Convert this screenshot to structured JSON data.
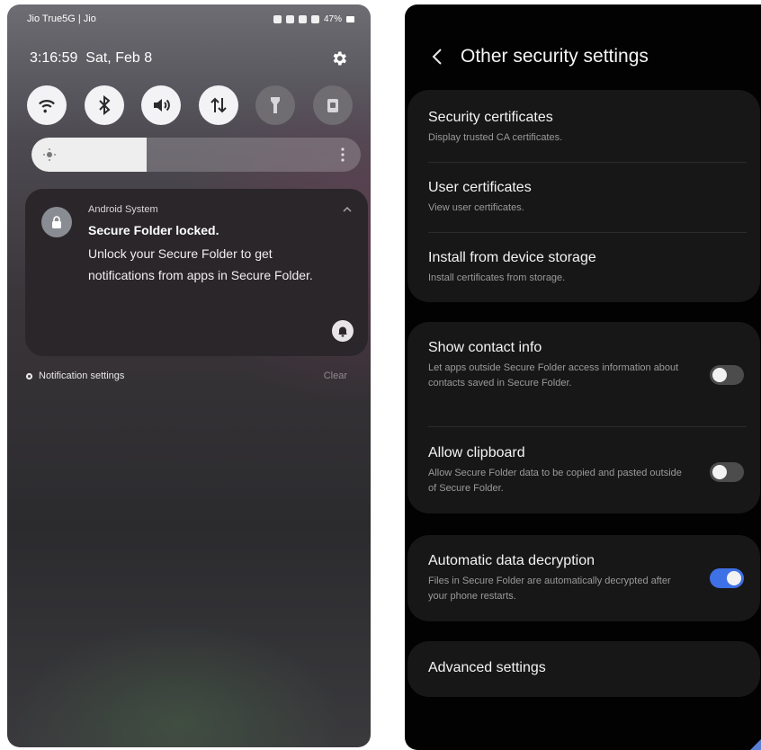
{
  "shade": {
    "status": {
      "carrier": "Jio True5G | Jio",
      "battery": "47%"
    },
    "clock": {
      "time": "3:16:59",
      "date": "Sat, Feb 8"
    },
    "quick_settings": [
      {
        "name": "wifi",
        "on": true
      },
      {
        "name": "bluetooth",
        "on": true
      },
      {
        "name": "sound",
        "on": true
      },
      {
        "name": "mobile-data",
        "on": true
      },
      {
        "name": "flashlight",
        "on": false
      },
      {
        "name": "lock",
        "on": false
      }
    ],
    "brightness_level": 0.35,
    "notification": {
      "app": "Android System",
      "title": "Secure Folder locked.",
      "body": "Unlock your Secure Folder to get notifications from apps in Secure Folder."
    },
    "footer": {
      "settings_label": "Notification settings",
      "clear_label": "Clear"
    }
  },
  "settings": {
    "title": "Other security settings",
    "group1": [
      {
        "title": "Security certificates",
        "subtitle": "Display trusted CA certificates."
      },
      {
        "title": "User certificates",
        "subtitle": "View user certificates."
      },
      {
        "title": "Install from device storage",
        "subtitle": "Install certificates from storage."
      }
    ],
    "group2": [
      {
        "title": "Show contact info",
        "subtitle": "Let apps outside Secure Folder access information about contacts saved in Secure Folder.",
        "enabled": false
      },
      {
        "title": "Allow clipboard",
        "subtitle": "Allow Secure Folder data to be copied and pasted outside of Secure Folder.",
        "enabled": false
      }
    ],
    "group3": [
      {
        "title": "Automatic data decryption",
        "subtitle": "Files in Secure Folder are automatically decrypted after your phone restarts.",
        "enabled": true
      }
    ],
    "advanced": {
      "title": "Advanced settings"
    },
    "accent_color": "#3e70e6"
  }
}
